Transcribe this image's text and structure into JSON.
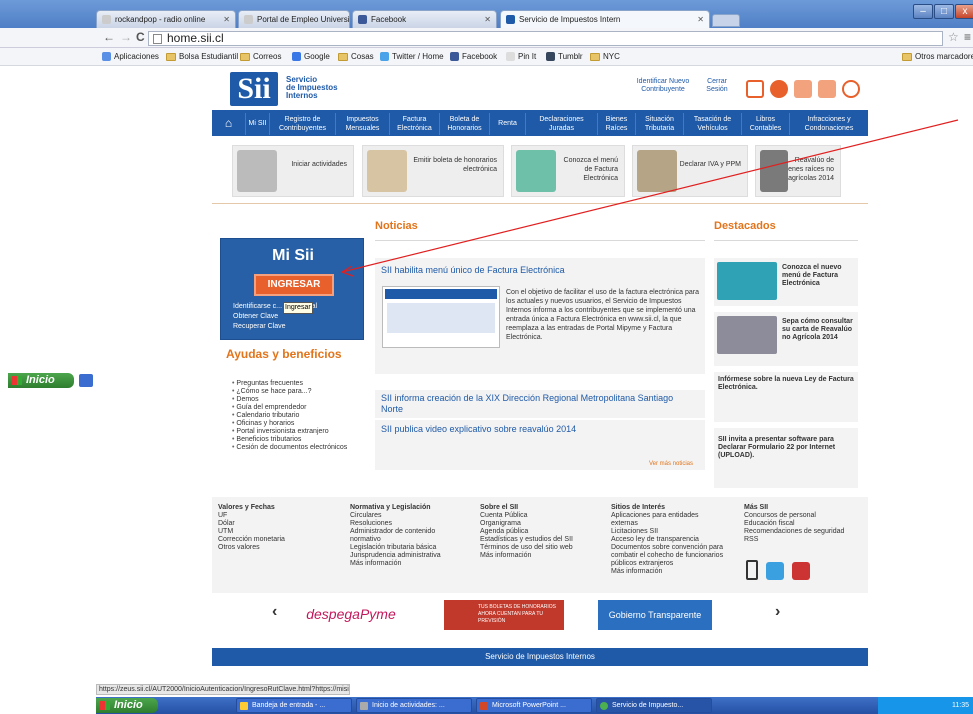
{
  "browser": {
    "tabs": [
      {
        "label": "rockandpop - radio online"
      },
      {
        "label": "Portal de Empleo Universida"
      },
      {
        "label": "Facebook"
      },
      {
        "label": "Servicio de Impuestos Intern"
      }
    ],
    "url": "home.sii.cl",
    "bookmarks": [
      "Aplicaciones",
      "Bolsa Estudiantil",
      "Correos",
      "Google",
      "Cosas",
      "Twitter / Home",
      "Facebook",
      "Pin It",
      "Tumblr",
      "NYC"
    ],
    "other_bookmarks": "Otros marcadore"
  },
  "header": {
    "logo": "Sii",
    "name_lines": [
      "Servicio",
      "de Impuestos",
      "Internos"
    ],
    "identificar": "Identificar Nuevo Contribuyente",
    "cerrar": "Cerrar Sesión"
  },
  "menu": [
    {
      "label": "Mi SII"
    },
    {
      "label": "Registro de Contribuyentes"
    },
    {
      "label": "Impuestos Mensuales"
    },
    {
      "label": "Factura Electrónica"
    },
    {
      "label": "Boleta de Honorarios"
    },
    {
      "label": "Renta"
    },
    {
      "label": "Declaraciones Juradas"
    },
    {
      "label": "Bienes Raíces"
    },
    {
      "label": "Situación Tributaria"
    },
    {
      "label": "Tasación de Vehículos"
    },
    {
      "label": "Libros Contables"
    },
    {
      "label": "Infracciones y Condonaciones"
    }
  ],
  "banners": [
    "Iniciar actividades",
    "Emitir boleta de honorarios electrónica",
    "Conozca el menú de Factura Electrónica",
    "Declarar IVA y PPM",
    "Reavalúo de bienes raíces no agrícolas 2014"
  ],
  "misii": {
    "title": "Mi Sii",
    "button": "INGRESAR",
    "tooltip": "Ingresar",
    "link1": "Identificarse c... ado Digital",
    "link2": "Obtener Clave",
    "link3": "Recuperar Clave"
  },
  "ayudas": {
    "title": "Ayudas y beneficios",
    "items": [
      "Preguntas frecuentes",
      "¿Cómo se hace para...?",
      "Demos",
      "Guía del emprendedor",
      "Calendario tributario",
      "Oficinas y horarios",
      "Portal inversionista extranjero",
      "Beneficios tributarios",
      "Cesión de documentos electrónicos"
    ]
  },
  "noticias": {
    "title": "Noticias",
    "main_title": "SII habilita menú único de Factura Electrónica",
    "main_text": "Con el objetivo de facilitar el uso de la factura electrónica para los actuales y nuevos usuarios, el Servicio de Impuestos Internos informa a los contribuyentes que se implementó una entrada única a Factura Electrónica en www.sii.cl, la que reemplaza a las entradas de Portal Mipyme y Factura Electrónica.",
    "news2": "SII informa creación de la XIX Dirección Regional Metropolitana Santiago Norte",
    "news3": "SII publica video explicativo sobre reavalúo 2014",
    "vermas": "Ver más noticias"
  },
  "destacados": {
    "title": "Destacados",
    "d1": "Conozca el nuevo menú de Factura Electrónica",
    "d2": "Sepa cómo consultar su carta de Reavalúo no Agrícola 2014",
    "d3": "Infórmese sobre la nueva Ley de Factura Electrónica.",
    "d4": "SII invita a presentar software para Declarar Formulario 22 por Internet (UPLOAD)."
  },
  "footer": {
    "c1": {
      "h": "Valores y Fechas",
      "items": [
        "UF",
        "Dólar",
        "UTM",
        "Corrección monetaria",
        "Otros valores"
      ]
    },
    "c2": {
      "h": "Normativa y Legislación",
      "items": [
        "Circulares",
        "Resoluciones",
        "Administrador de contenido",
        "normativo",
        "Legislación tributaria básica",
        "Jurisprudencia administrativa",
        "Más información"
      ]
    },
    "c3": {
      "h": "Sobre el SII",
      "items": [
        "Cuenta Pública",
        "Organigrama",
        "Agenda pública",
        "Estadísticas y estudios del SII",
        "Términos de uso del sitio web",
        "Más información"
      ]
    },
    "c4": {
      "h": "Sitios de Interés",
      "items": [
        "Aplicaciones para entidades",
        "externas",
        "Licitaciones SII",
        "Acceso ley de transparencia",
        "Documentos sobre convención para",
        "combatir el cohecho de funcionarios",
        "públicos extranjeros",
        "Más información"
      ]
    },
    "c5": {
      "h": "Más SII",
      "items": [
        "Concursos de personal",
        "Educación fiscal",
        "Recomendaciones de seguridad",
        "RSS"
      ]
    }
  },
  "partners": {
    "p1": "despegaPyme",
    "p2": "TUS BOLETAS DE HONORARIOS AHORA CUENTAN PARA TU PREVISIÓN",
    "p3": "Gobierno Transparente"
  },
  "bottom": "Servicio de Impuestos Internos",
  "status": "https://zeus.sii.cl/AUT2000/InicioAutenticacion/IngresoRutClave.html?https://misii.sii...",
  "taskbar": {
    "start": "Inicio",
    "items": [
      "Bandeja de entrada - ...",
      "Inicio de actividades: ...",
      "Microsoft PowerPoint ...",
      "Servicio de Impuesto..."
    ],
    "time": "11:35"
  },
  "colors": {
    "sii_blue": "#1f5aa8",
    "orange": "#e2741b",
    "ingresar": "#e8612c"
  }
}
